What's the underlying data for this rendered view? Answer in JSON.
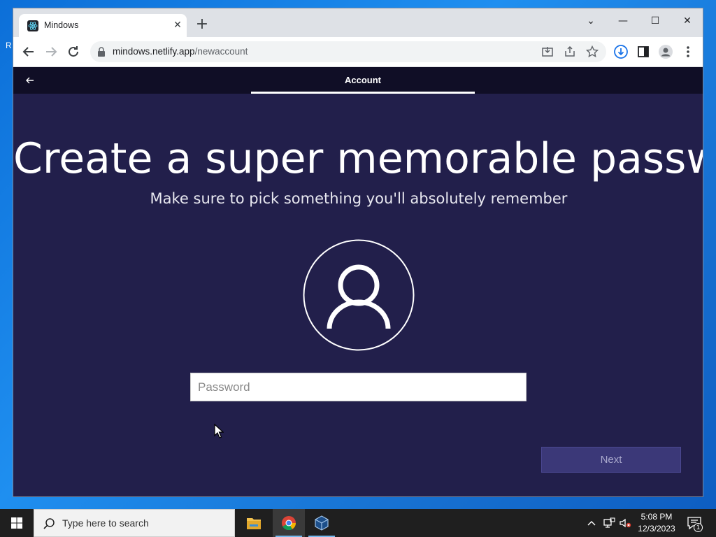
{
  "desktop": {
    "edge_letter": "R"
  },
  "browser": {
    "tab_title": "Mindows",
    "tab_close": "✕",
    "new_tab": "+",
    "window_controls": {
      "dropdown": "⌄",
      "minimize": "—",
      "maximize": "☐",
      "close": "✕"
    },
    "url_host": "mindows.netlify.app",
    "url_path": "/newaccount"
  },
  "page": {
    "header_tab": "Account",
    "headline": "Create a super memorable password",
    "subheadline": "Make sure to pick something you'll absolutely remember",
    "password_placeholder": "Password",
    "password_value": "",
    "next_label": "Next"
  },
  "taskbar": {
    "search_placeholder": "Type here to search",
    "time": "5:08 PM",
    "date": "12/3/2023",
    "notification_count": "1"
  },
  "colors": {
    "page_bg": "#221f4b",
    "header_bg": "#100e26",
    "next_bg": "#3b3878",
    "taskbar_bg": "#1f1f1f"
  }
}
